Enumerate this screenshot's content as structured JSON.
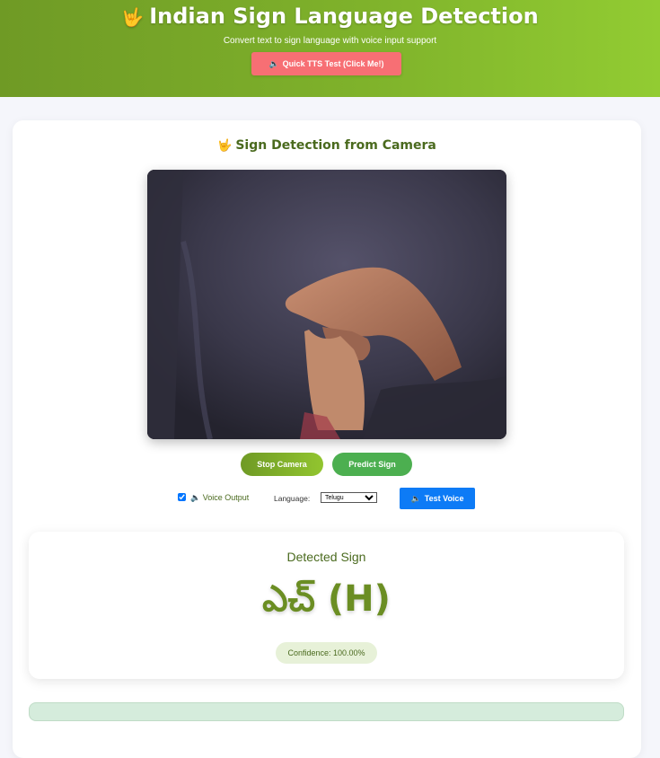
{
  "header": {
    "title": "Indian Sign Language Detection",
    "subtitle": "Convert text to sign language with voice input support",
    "tts_button": "Quick TTS Test (Click Me!)",
    "hand_icon": "🤟"
  },
  "camera_section": {
    "title": "Sign Detection from Camera",
    "hand_icon": "🤟"
  },
  "buttons": {
    "stop_camera": "Stop Camera",
    "predict_sign": "Predict Sign",
    "test_voice": "Test Voice"
  },
  "controls": {
    "voice_output_label": "Voice Output",
    "voice_output_checked": true,
    "language_label": "Language:",
    "language_selected": "Telugu"
  },
  "result": {
    "label": "Detected Sign",
    "sign": "ఎచ్ (H)",
    "confidence": "Confidence: 100.00%"
  },
  "colors": {
    "accent_green": "#6b8e23",
    "tts_button": "#f76f74",
    "test_voice_button": "#0d7bf6",
    "predict_button": "#4caf50"
  }
}
